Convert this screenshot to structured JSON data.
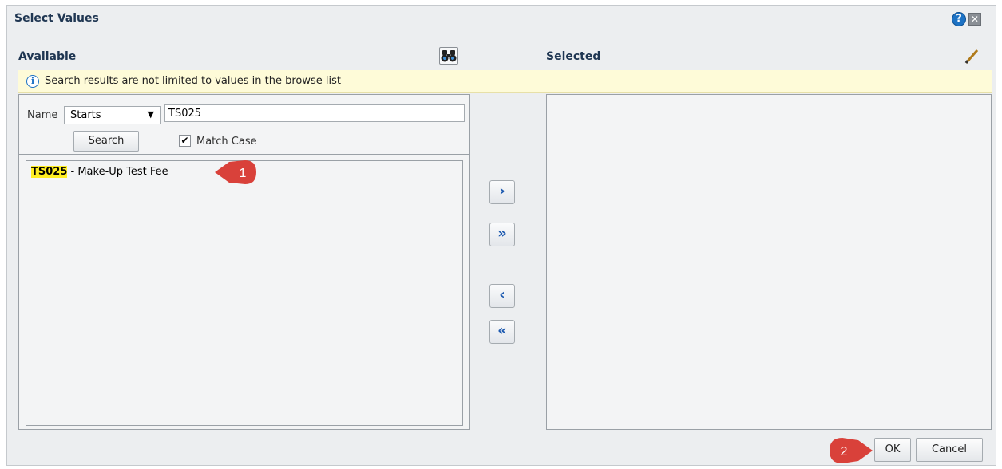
{
  "dialog": {
    "title": "Select Values",
    "help_icon": "question-icon",
    "close_icon": "close-icon"
  },
  "available": {
    "label": "Available",
    "search_icon": "binoculars-icon"
  },
  "selected": {
    "label": "Selected",
    "edit_icon": "pencil-icon"
  },
  "info": {
    "text": "Search results are not limited to values in the browse list",
    "icon": "info-icon"
  },
  "search": {
    "name_label": "Name",
    "operator_value": "Starts",
    "input_value": "TS025",
    "search_label": "Search",
    "match_case_label": "Match Case",
    "match_case_checked": true
  },
  "results": [
    {
      "code": "TS025",
      "rest": " - Make-Up Test Fee"
    }
  ],
  "shuttle": {
    "move": "move-right-icon",
    "move_all": "move-all-right-icon",
    "remove": "move-left-icon",
    "remove_all": "move-all-left-icon"
  },
  "callouts": {
    "one": "1",
    "two": "2"
  },
  "buttons": {
    "ok": "OK",
    "cancel": "Cancel"
  },
  "colors": {
    "callout": "#d9413a",
    "highlight": "#ffee22",
    "title": "#1f3652"
  }
}
